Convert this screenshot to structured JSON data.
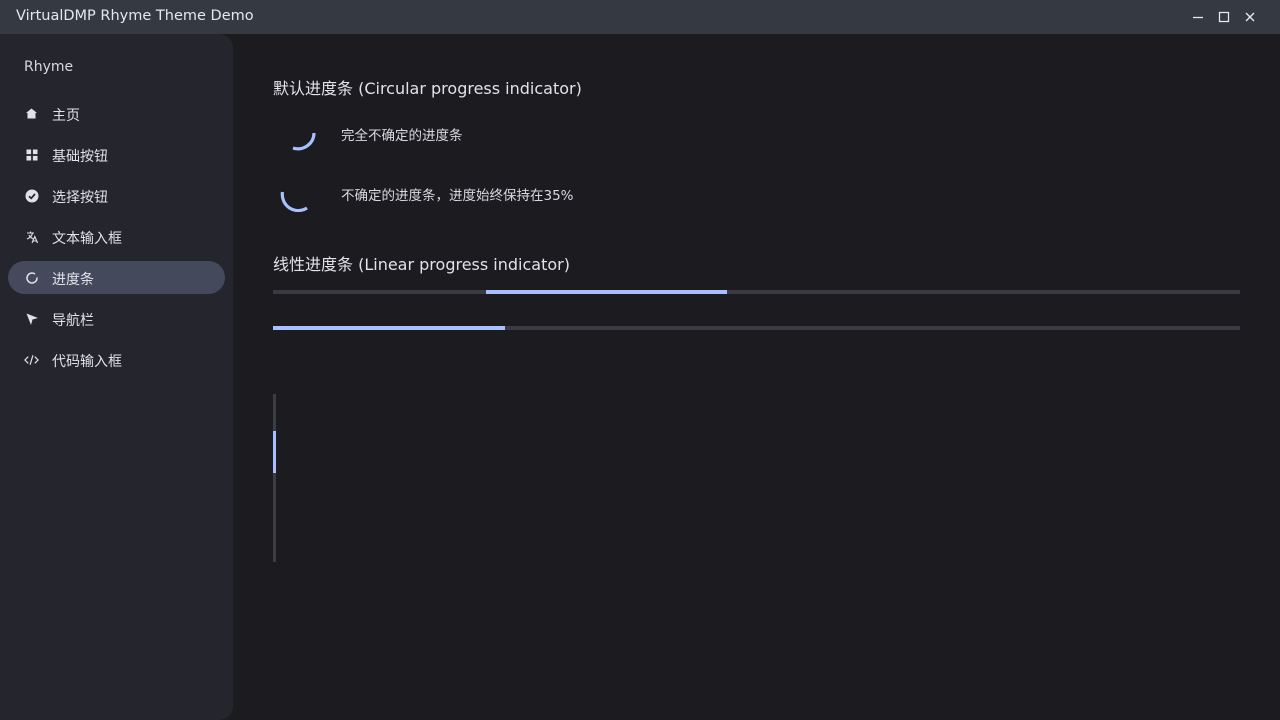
{
  "window": {
    "title": "VirtualDMP Rhyme Theme Demo",
    "controls": [
      "minimize-icon",
      "maximize-icon",
      "close-icon"
    ]
  },
  "sidebar": {
    "app_name": "Rhyme",
    "items": [
      {
        "label": "主页",
        "icon": "home-icon",
        "active": false
      },
      {
        "label": "基础按钮",
        "icon": "grid-icon",
        "active": false
      },
      {
        "label": "选择按钮",
        "icon": "check-circle-icon",
        "active": false
      },
      {
        "label": "文本输入框",
        "icon": "translate-icon",
        "active": false
      },
      {
        "label": "进度条",
        "icon": "progress-icon",
        "active": true
      },
      {
        "label": "导航栏",
        "icon": "navigation-arrow-icon",
        "active": false
      },
      {
        "label": "代码输入框",
        "icon": "code-icon",
        "active": false
      }
    ]
  },
  "main": {
    "circular_title": "默认进度条 (Circular progress indicator)",
    "circular": [
      {
        "label": "完全不确定的进度条",
        "progress": null
      },
      {
        "label": "不确定的进度条，进度始终保持在35%",
        "progress": 0.35
      }
    ],
    "linear_title": "线性进度条 (Linear progress indicator)",
    "linear": [
      {
        "indeterminate": true,
        "segment_start": 0.22,
        "segment_end": 0.47
      },
      {
        "indeterminate": false,
        "progress": 0.24
      }
    ],
    "vertical": {
      "segment_start": 0.22,
      "segment_end": 0.47
    }
  },
  "colors": {
    "accent": "#a8c0ff",
    "track": "#3a3b42",
    "background": "#1b1b20",
    "sidebar": "#25262d",
    "titlebar": "#353942",
    "active_item": "#444a5c"
  }
}
